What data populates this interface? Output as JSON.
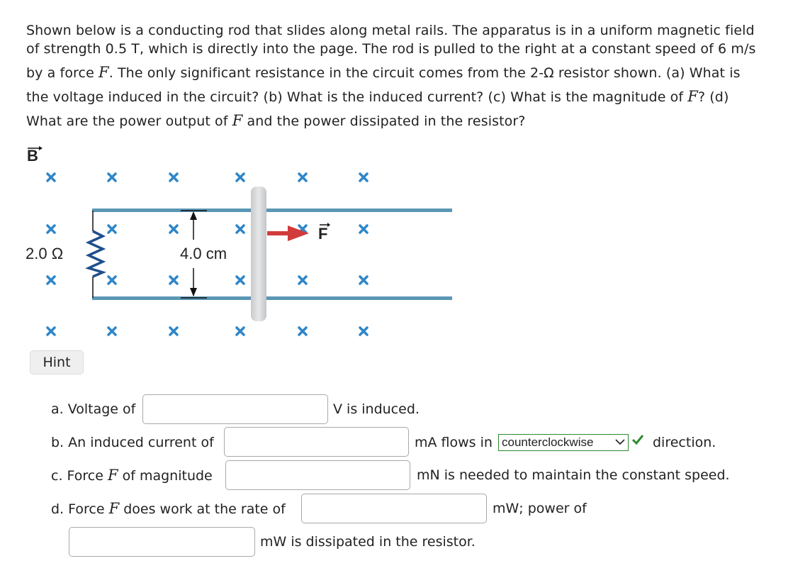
{
  "problem": {
    "line1": "Shown below is a conducting rod that slides along metal rails. The apparatus is in a uniform magnetic field",
    "line2": "of strength 0.5 T, which is directly into the page. The rod is pulled to the right at a constant speed of 6 m/s",
    "line3_pre": "by a force ",
    "line3_post": ". The only significant resistance in the circuit comes from the 2-Ω resistor shown. (a) What is",
    "line4_pre": "the voltage induced in the circuit? (b) What is the induced current? (c) What is the magnitude of ",
    "line4_post": "? (d)",
    "line5_pre": "What are the power output of ",
    "line5_post": " and the power dissipated in the resistor?",
    "force_symbol": "F"
  },
  "figure": {
    "field_label": "B",
    "resistor_label": "2.0 Ω",
    "separation_label": "4.0 cm",
    "force_label": "F",
    "colors": {
      "field_x": "#2f86c8",
      "rail": "#5b97b5",
      "rod": "#d9dadc",
      "force_arrow": "#d23b3b",
      "resistor": "#1f4f8c"
    }
  },
  "hint": {
    "label": "Hint"
  },
  "questions": {
    "a": {
      "prefix": "a. Voltage of",
      "value": "",
      "suffix": "V is induced."
    },
    "b": {
      "prefix": "b. An induced current of",
      "value": "",
      "suffix_pre": "mA flows in",
      "direction_selected": "counterclockwise",
      "direction_status": "correct",
      "suffix_post": "direction."
    },
    "c": {
      "prefix_a": "c. Force ",
      "symbol": "F",
      "prefix_b": " of magnitude",
      "value": "",
      "suffix": "mN is needed to maintain the constant speed."
    },
    "d": {
      "prefix_a": "d. Force ",
      "symbol": "F",
      "prefix_b": " does work at the rate of",
      "value1": "",
      "mid": "mW; power of",
      "value2": "",
      "suffix": "mW is dissipated in the resistor."
    }
  },
  "status_colors": {
    "correct": "#2e8b2e"
  }
}
